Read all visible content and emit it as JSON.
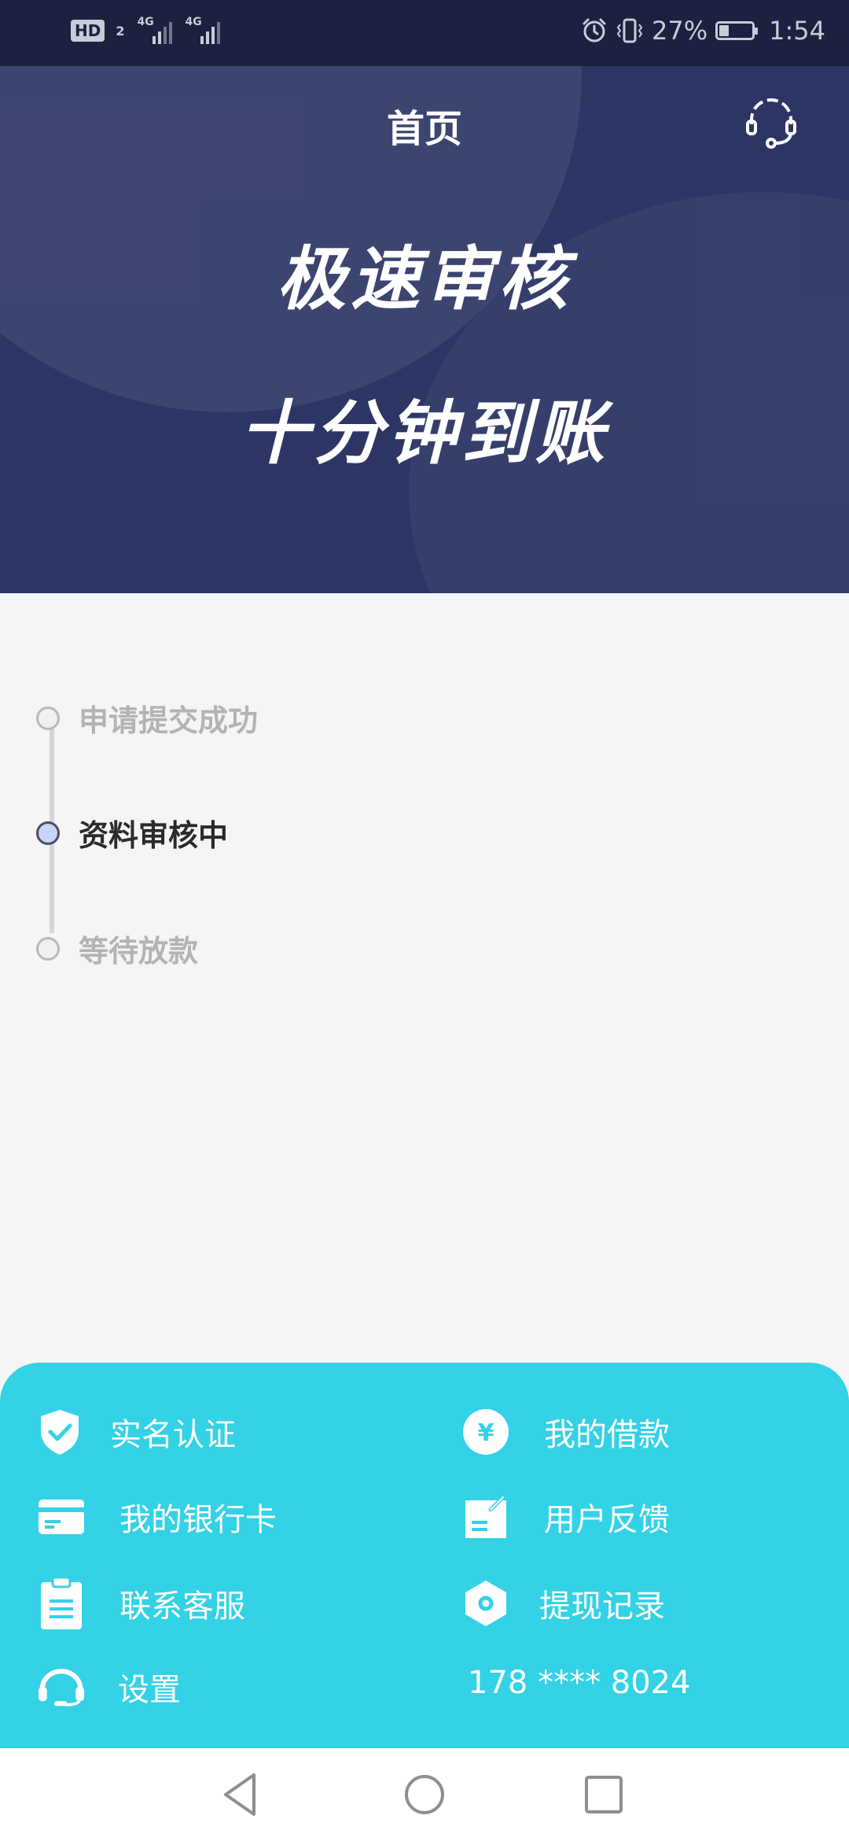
{
  "status_bar": {
    "hd_label": "HD",
    "sim_number": "2",
    "network_1": "4G",
    "network_2": "4G",
    "battery_percent": "27%",
    "time": "1:54",
    "icons": [
      "alarm-icon",
      "vibrate-icon",
      "battery-icon"
    ]
  },
  "header": {
    "title": "首页",
    "service_icon": "headset-icon"
  },
  "banner": {
    "line1": "极速审核",
    "line2": "十分钟到账"
  },
  "progress": {
    "steps": [
      {
        "label": "申请提交成功",
        "state": "done"
      },
      {
        "label": "资料审核中",
        "state": "current"
      },
      {
        "label": "等待放款",
        "state": "pending"
      }
    ]
  },
  "menu": {
    "items": [
      {
        "label": "实名认证",
        "icon": "shield-check-icon"
      },
      {
        "label": "我的借款",
        "icon": "yen-coin-icon"
      },
      {
        "label": "我的银行卡",
        "icon": "bank-card-icon"
      },
      {
        "label": "用户反馈",
        "icon": "feedback-icon"
      },
      {
        "label": "联系客服",
        "icon": "clipboard-icon"
      },
      {
        "label": "提现记录",
        "icon": "hexagon-icon"
      },
      {
        "label": "设置",
        "icon": "headset-icon"
      }
    ],
    "phone": "178 **** 8024"
  },
  "colors": {
    "status_bar": "#1d2140",
    "banner": "#2c3564",
    "menu_panel": "#33d2e6",
    "page_bg": "#f5f5f5",
    "step_active_dot": "#c8d4f8"
  },
  "nav_bar": {
    "icons": [
      "back-icon",
      "home-icon",
      "recents-icon"
    ]
  }
}
